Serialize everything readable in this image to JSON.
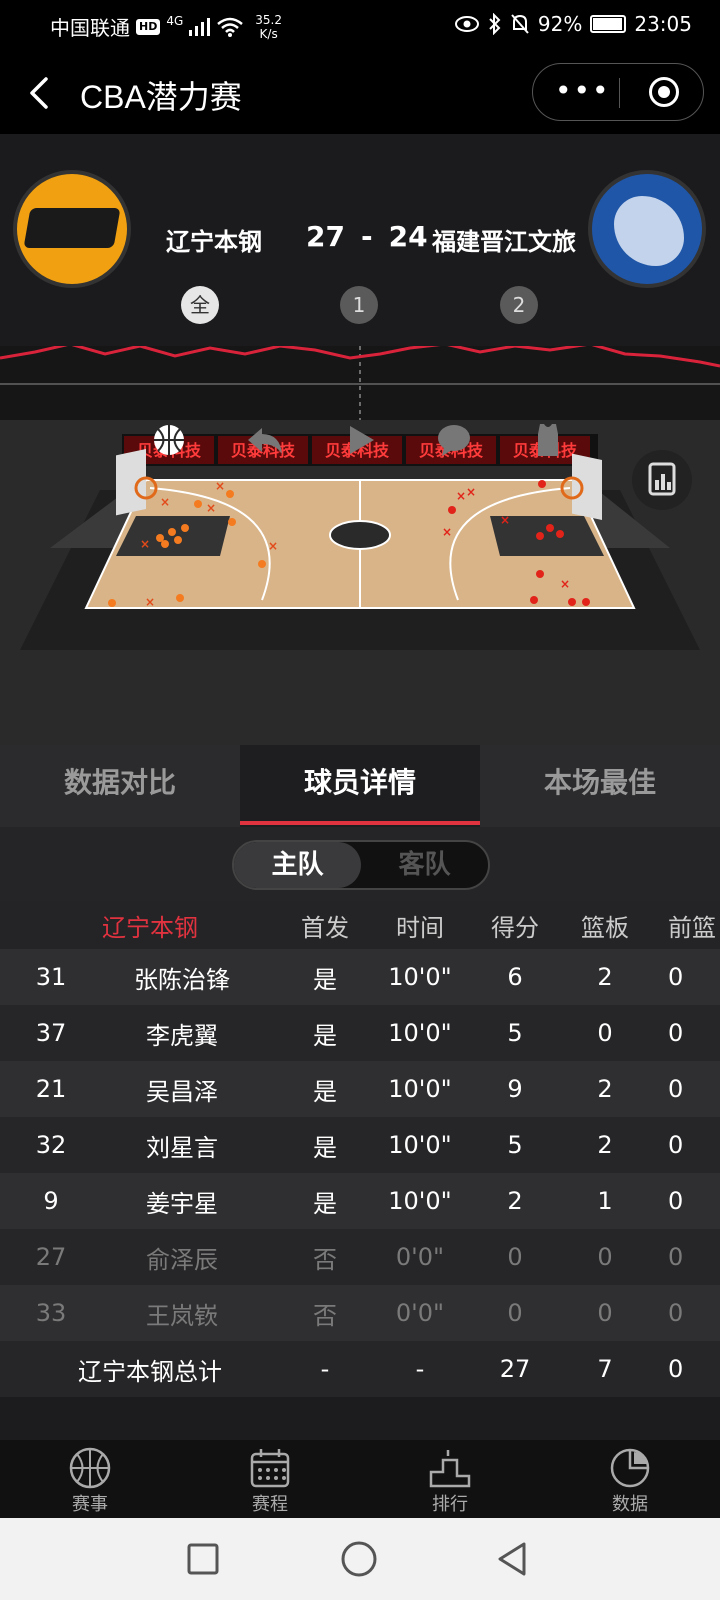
{
  "status": {
    "carrier": "中国联通",
    "hd": "HD",
    "signal": "4G",
    "speed": "35.2",
    "speed_unit": "K/s",
    "battery": "92%",
    "time": "23:05"
  },
  "nav": {
    "title": "CBA潜力赛",
    "more": "•••"
  },
  "match": {
    "home": "辽宁本钢",
    "away": "福建晋江文旅",
    "home_score": "27",
    "separator": "-",
    "away_score": "24",
    "periods": [
      "全",
      "1",
      "2"
    ]
  },
  "court": {
    "sponsor": "贝泰科技",
    "home_color": "#f47b20",
    "away_color": "#e2231a"
  },
  "tabs": [
    "数据对比",
    "球员详情",
    "本场最佳"
  ],
  "segment": [
    "主队",
    "客队"
  ],
  "table": {
    "team": "辽宁本钢",
    "columns": [
      "首发",
      "时间",
      "得分",
      "篮板",
      "前篮"
    ],
    "rows": [
      {
        "num": "31",
        "name": "张陈治锋",
        "start": "是",
        "time": "10'0\"",
        "pts": "6",
        "reb": "2",
        "front": "0"
      },
      {
        "num": "37",
        "name": "李虎翼",
        "start": "是",
        "time": "10'0\"",
        "pts": "5",
        "reb": "0",
        "front": "0"
      },
      {
        "num": "21",
        "name": "吴昌泽",
        "start": "是",
        "time": "10'0\"",
        "pts": "9",
        "reb": "2",
        "front": "0"
      },
      {
        "num": "32",
        "name": "刘星言",
        "start": "是",
        "time": "10'0\"",
        "pts": "5",
        "reb": "2",
        "front": "0"
      },
      {
        "num": "9",
        "name": "姜宇星",
        "start": "是",
        "time": "10'0\"",
        "pts": "2",
        "reb": "1",
        "front": "0"
      },
      {
        "num": "27",
        "name": "俞泽辰",
        "start": "否",
        "time": "0'0\"",
        "pts": "0",
        "reb": "0",
        "front": "0"
      },
      {
        "num": "33",
        "name": "王岚嵚",
        "start": "否",
        "time": "0'0\"",
        "pts": "0",
        "reb": "0",
        "front": "0"
      }
    ],
    "total": {
      "name": "辽宁本钢总计",
      "start": "-",
      "time": "-",
      "pts": "27",
      "reb": "7",
      "front": "0"
    }
  },
  "bottom_nav": [
    "赛事",
    "赛程",
    "排行",
    "数据"
  ]
}
